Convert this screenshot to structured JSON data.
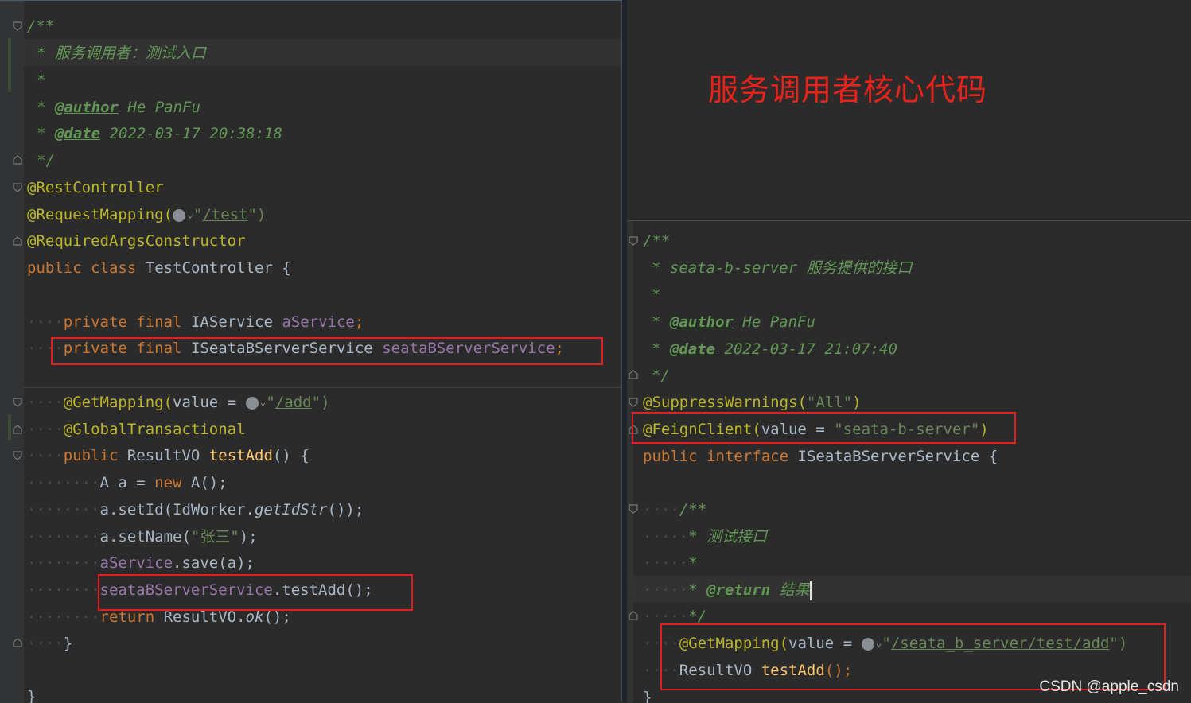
{
  "title": "服务调用者核心代码",
  "watermark": "CSDN @apple_csdn",
  "left_file": {
    "doc_open": "/**",
    "doc_line1": "* 服务调用者：测试入口",
    "doc_star": "*",
    "author_tag": "@author",
    "author_value": " He PanFu",
    "date_tag": "@date",
    "date_value": " 2022-03-17 20:38:18",
    "doc_close": "*/",
    "ann_rest": "@RestController",
    "ann_request_mapping": "@RequestMapping(",
    "request_mapping_quote_open": "\"",
    "request_mapping_url": "/test",
    "request_mapping_close": "\")",
    "ann_required_args": "@RequiredArgsConstructor",
    "kw_public": "public",
    "kw_class": "class",
    "class_name": "TestController",
    "brace_open": "{",
    "kw_private": "private",
    "kw_final": "final",
    "type_iaservice": "IAService",
    "field_aservice": "aService",
    "semicolon": ";",
    "type_iseata": "ISeataBServerService",
    "field_seata": "seataBServerService",
    "ann_getmapping": "@GetMapping(",
    "param_value": "value",
    "equals": " = ",
    "getmapping_quote_open": "\"",
    "getmapping_url": "/add",
    "getmapping_close": "\")",
    "ann_global_tx": "@GlobalTransactional",
    "return_type": "ResultVO",
    "method_testadd": "testAdd",
    "parens_brace": "() {",
    "stmt1_decl": "A a = ",
    "kw_new": "new",
    "stmt1_rest": " A();",
    "stmt2_prefix": "a.setId(IdWorker.",
    "stmt2_italic": "getIdStr",
    "stmt2_suffix": "());",
    "stmt3_prefix": "a.setName(",
    "stmt3_str": "\"张三\"",
    "stmt3_suffix": ");",
    "stmt4_field": "aService",
    "stmt4_rest": ".save(a);",
    "stmt5_field": "seataBServerService",
    "stmt5_rest": ".testAdd();",
    "kw_return": "return",
    "stmt6_type": " ResultVO.",
    "stmt6_italic": "ok",
    "stmt6_suffix": "();",
    "brace_close": "}"
  },
  "right_file": {
    "doc_open": "/**",
    "doc_line1": "* seata-b-server 服务提供的接口",
    "doc_star": "*",
    "author_tag": "@author",
    "author_value": " He PanFu",
    "date_tag": "@date",
    "date_value": " 2022-03-17 21:07:40",
    "doc_close": "*/",
    "ann_suppress": "@SuppressWarnings(",
    "suppress_str": "\"All\"",
    "paren_close": ")",
    "ann_feign": "@FeignClient(",
    "param_value": "value",
    "equals": " = ",
    "feign_str": "\"seata-b-server\"",
    "kw_public": "public",
    "kw_interface": "interface",
    "interface_name": "ISeataBServerService",
    "brace_open": "{",
    "inner_doc_open": "/**",
    "inner_doc_line1": "* 测试接口",
    "inner_doc_star": "*",
    "return_tag": "@return",
    "return_value": " 结果",
    "inner_doc_close": "*/",
    "ann_getmapping": "@GetMapping(",
    "getmapping_quote_open": "\"",
    "getmapping_url": "/seata_b_server/test/add",
    "getmapping_close": "\")",
    "return_type": "ResultVO",
    "method_testadd": "testAdd",
    "method_suffix": "();",
    "brace_close": "}"
  },
  "colors": {
    "annotation": "#bbb529",
    "keyword": "#cc7832",
    "string": "#6a8759",
    "doc": "#629755",
    "field": "#9876aa",
    "method": "#ffc66d",
    "highlight_box": "#e02020",
    "title": "#e8231b"
  }
}
